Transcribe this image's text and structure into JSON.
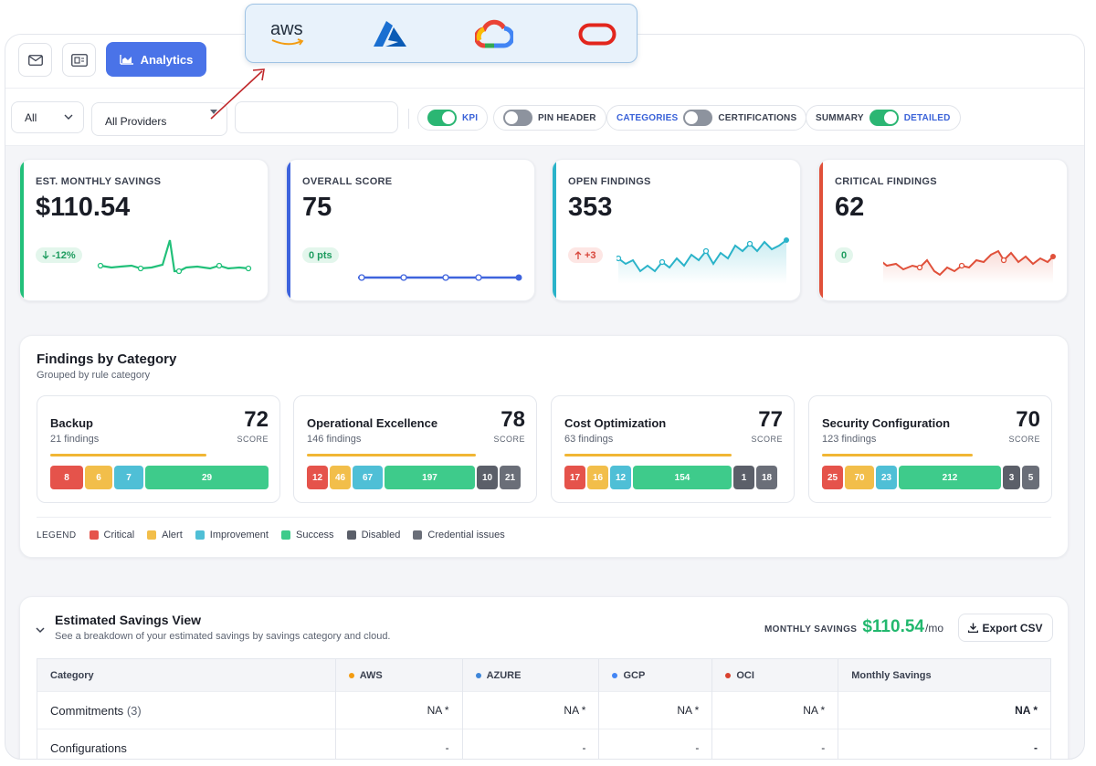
{
  "toolbar": {
    "analytics_label": "Analytics",
    "icons": [
      "mail-icon",
      "report-icon",
      "chart-icon"
    ]
  },
  "filters": {
    "scope_value": "All",
    "provider_value": "All Providers",
    "toggles": {
      "kpi": {
        "label": "KPI",
        "on": true
      },
      "pin_header": {
        "label": "PIN HEADER",
        "on": false
      },
      "categories": "CATEGORIES",
      "certifications": "CERTIFICATIONS",
      "summary": "SUMMARY",
      "detailed": "DETAILED"
    }
  },
  "providers_popup": {
    "aws_text": "aws",
    "icons": [
      "aws-logo",
      "azure-logo",
      "gcp-logo",
      "oracle-logo"
    ]
  },
  "kpis": [
    {
      "title": "EST. MONTHLY SAVINGS",
      "value": "$110.54",
      "delta": "-12%",
      "delta_dir": "down",
      "color": "#22c07a"
    },
    {
      "title": "OVERALL SCORE",
      "value": "75",
      "delta": "0 pts",
      "delta_dir": "none",
      "color": "#3e63dd"
    },
    {
      "title": "OPEN FINDINGS",
      "value": "353",
      "delta": "+3",
      "delta_dir": "up",
      "color": "#2ab3c9"
    },
    {
      "title": "CRITICAL FINDINGS",
      "value": "62",
      "delta": "0",
      "delta_dir": "none",
      "color": "#e0503a"
    }
  ],
  "findings": {
    "title": "Findings by Category",
    "subtitle": "Grouped by rule category",
    "score_label": "SCORE",
    "categories": [
      {
        "name": "Backup",
        "count": "21 findings",
        "score": "72",
        "segments": {
          "critical": "8",
          "alert": "6",
          "improvement": "7",
          "success": "29"
        }
      },
      {
        "name": "Operational Excellence",
        "count": "146 findings",
        "score": "78",
        "segments": {
          "critical": "12",
          "alert": "46",
          "improvement": "67",
          "success": "197",
          "disabled": "10",
          "credential": "21"
        }
      },
      {
        "name": "Cost Optimization",
        "count": "63 findings",
        "score": "77",
        "segments": {
          "critical": "17",
          "alert": "16",
          "improvement": "12",
          "success": "154",
          "disabled": "1",
          "credential": "18"
        }
      },
      {
        "name": "Security Configuration",
        "count": "123 findings",
        "score": "70",
        "segments": {
          "critical": "25",
          "alert": "70",
          "improvement": "23",
          "success": "212",
          "disabled": "3",
          "credential": "5"
        }
      }
    ],
    "legend": {
      "heading": "LEGEND",
      "items": [
        "Critical",
        "Alert",
        "Improvement",
        "Success",
        "Disabled",
        "Credential issues"
      ],
      "colors": {
        "critical": "#e5534b",
        "alert": "#f2be4a",
        "improvement": "#4fbfd6",
        "success": "#3ecb8b",
        "disabled": "#5b5f69",
        "credential": "#6a6e78"
      }
    }
  },
  "savings": {
    "title": "Estimated Savings View",
    "subtitle": "See a breakdown of your estimated savings by savings category and cloud.",
    "monthly_label": "MONTHLY SAVINGS",
    "monthly_value": "$110.54",
    "monthly_unit": "/mo",
    "export_label": "Export CSV",
    "columns": [
      "Category",
      "AWS",
      "AZURE",
      "GCP",
      "OCI",
      "Monthly Savings"
    ],
    "column_dot_colors": [
      "",
      "#f39c12",
      "#3e86d9",
      "#4285f4",
      "#d9412f",
      ""
    ],
    "rows": [
      {
        "category": "Commitments",
        "count": "(3)",
        "aws": "NA *",
        "azure": "NA *",
        "gcp": "NA *",
        "oci": "NA *",
        "total": "NA *"
      },
      {
        "category": "Configurations",
        "count": "",
        "aws": "-",
        "azure": "-",
        "gcp": "-",
        "oci": "-",
        "total": "-"
      }
    ]
  }
}
